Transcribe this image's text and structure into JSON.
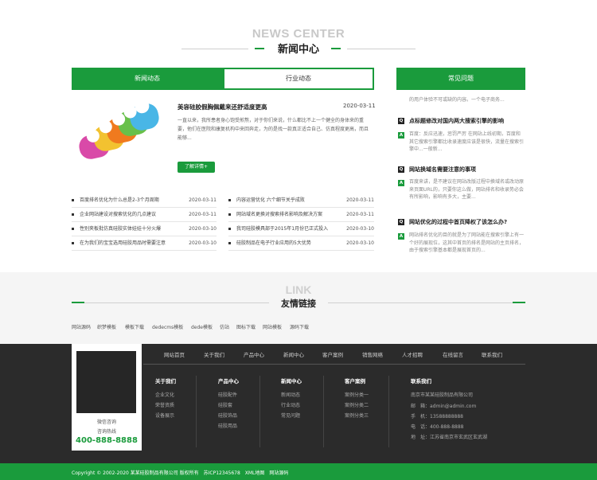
{
  "news_section": {
    "title_en": "NEWS CENTER",
    "title_cn": "新闻中心",
    "tabs": [
      {
        "label": "新闻动态",
        "active": true
      },
      {
        "label": "行业动态",
        "active": false
      }
    ],
    "featured": {
      "title": "美容硅胶假胸佩戴来还舒适度更高",
      "date": "2020-03-11",
      "desc": "一直以来，我所患者身心饱受煎熬，对于你们来说，什么都比不上一个健全的身体来的重要，他们在医院和康复机构中来回奔走，为的是找一款真正适合自己、仿真程度更高，而且能够...",
      "more_label": "了解详情+"
    },
    "list_left": [
      {
        "text": "百度排名优化为什么总是2-3个月周期",
        "date": "2020-03-11"
      },
      {
        "text": "企业网站建设对搜索优化的几点建议",
        "date": "2020-03-11"
      },
      {
        "text": "性别夹板批仿真硅胶实体娃娃十分火爆",
        "date": "2020-03-10"
      },
      {
        "text": "在为我们的宝宝选用硅胶用品时需要注意",
        "date": "2020-03-10"
      }
    ],
    "list_right": [
      {
        "text": "内容运营优化 六个细节关乎成败",
        "date": "2020-03-11"
      },
      {
        "text": "网站域名更换对搜索排名影响及解决方案",
        "date": "2020-03-11"
      },
      {
        "text": "我司硅胶模具部于2015年1月份已正式投入",
        "date": "2020-03-10"
      },
      {
        "text": "硅胶制品在电子行业应用的5大优势",
        "date": "2020-03-10"
      }
    ]
  },
  "faq": {
    "title": "常见问题",
    "top_snippet": "的用户体验不可或缺的内容。一个电子商务...",
    "items": [
      {
        "q": "点标题修改对国内两大搜索引擎的影响",
        "a": "百度：反应迅速，惩罚严厉 在网站上线初期，百度和其它搜索引擎都比收录速度应该是很快，流量在搜索引擎中...一般新..."
      },
      {
        "q": "网站换域名需要注意的事项",
        "a": "百度来讲，是不建议在网站改版过程中换域名或改动原来页面URL的，只要你这么做，网站排名和收录势必会有所影响，影响有多大，主要..."
      },
      {
        "q": "网站优化的过程中首页降权了该怎么办?",
        "a": "网站排名优化的目的就是为了网站能在搜索引擎上有一个好的展现位，这其中首页的排名是网站的主页排名，由于搜索引擎基本都是展现首页的..."
      }
    ]
  },
  "links_section": {
    "title_en": "LINK",
    "title_cn": "友情链接",
    "links": [
      "网站源码",
      "织梦模板",
      "模板下载",
      "dedecms模板",
      "dede模板",
      "仿站",
      "图标下载",
      "网站模板",
      "源码下载"
    ]
  },
  "footer": {
    "nav": [
      "网站首页",
      "关于我们",
      "产品中心",
      "新闻中心",
      "客户案例",
      "销售网络",
      "人才招聘",
      "在线留言",
      "联系我们"
    ],
    "qr_caption": "微信咨询",
    "hotline_label": "咨询热线",
    "phone": "400-888-8888",
    "columns": [
      {
        "title": "关于我们",
        "items": [
          "企业文化",
          "荣誉资质",
          "设备展示"
        ]
      },
      {
        "title": "产品中心",
        "items": [
          "硅胶配件",
          "硅胶套",
          "硅胶饰品",
          "硅胶用品"
        ]
      },
      {
        "title": "新闻中心",
        "items": [
          "新闻动态",
          "行业动态",
          "常见问题"
        ]
      },
      {
        "title": "客户案例",
        "items": [
          "案例分类一",
          "案例分类二",
          "案例分类三"
        ]
      }
    ],
    "contact": {
      "title": "联系我们",
      "company": "南京市某某硅胶制品有限公司",
      "email": "邮　箱：admin@admin.com",
      "mobile": "手　机：13588888888",
      "tel": "电　话：400-888-8888",
      "address": "地　址：江苏省南京市玄武区玄武湖"
    },
    "copyright": "Copyright © 2002-2020 某某硅胶制品有限公司 版权所有　苏ICP12345678　XML地图　网站源码"
  },
  "colors": {
    "accent": "#1a9b3c",
    "footer_bg": "#2b2b2b"
  }
}
